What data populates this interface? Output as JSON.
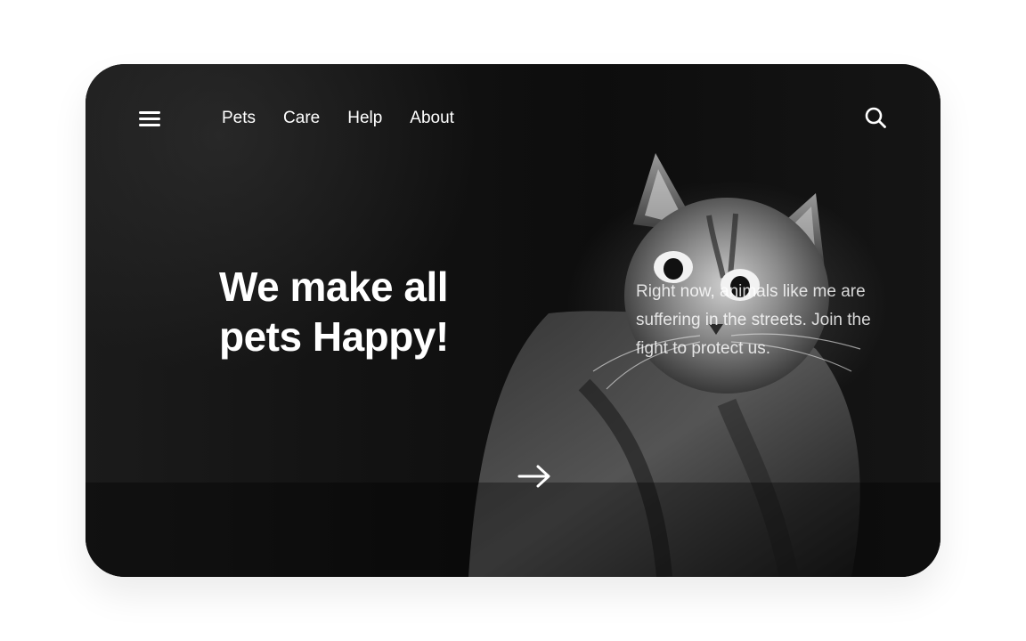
{
  "nav": {
    "menu_icon": "hamburger-menu-icon",
    "links": [
      {
        "label": "Pets"
      },
      {
        "label": "Care"
      },
      {
        "label": "Help"
      },
      {
        "label": "About"
      }
    ],
    "search_icon": "search-icon"
  },
  "hero": {
    "headline": "We make all pets Happy!",
    "description": "Right now, animals like me are suffering in the streets. Join the fight to protect us.",
    "cta_icon": "arrow-right-icon",
    "background_image": "black-and-white cat photo"
  },
  "colors": {
    "page_background": "#ffffff",
    "card_background": "#0b0b0b",
    "text": "#ffffff"
  }
}
